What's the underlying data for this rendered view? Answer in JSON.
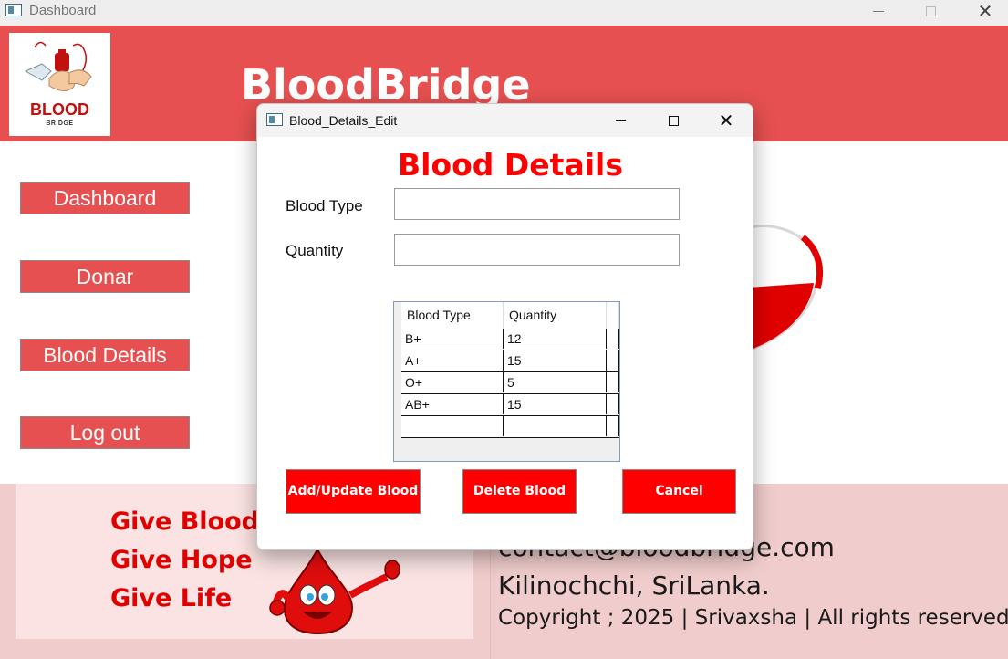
{
  "main_window": {
    "title": "Dashboard"
  },
  "header": {
    "logo_text": "BLOOD",
    "logo_subtext": "BRIDGE",
    "app_title": "BloodBridge"
  },
  "nav": {
    "dashboard": "Dashboard",
    "donar": "Donar",
    "blood_details": "Blood Details",
    "logout": "Log out"
  },
  "footer": {
    "slogan_1": "Give Blood",
    "slogan_2": "Give Hope",
    "slogan_3": "Give Life",
    "email": "contact@bloodbridge.com",
    "address": "Kilinochchi, SriLanka.",
    "copyright": "Copyright ; 2025 | Srivaxsha | All rights reserved"
  },
  "dialog": {
    "title": "Blood_Details_Edit",
    "heading": "Blood Details",
    "blood_type_label": "Blood Type",
    "quantity_label": "Quantity",
    "blood_type_value": "",
    "quantity_value": "",
    "grid": {
      "headers": [
        "Blood Type",
        "Quantity"
      ],
      "rows": [
        [
          "B+",
          "12"
        ],
        [
          "A+",
          "15"
        ],
        [
          "O+",
          "5"
        ],
        [
          "AB+",
          "15"
        ],
        [
          "",
          ""
        ]
      ]
    },
    "buttons": {
      "add_update": "Add/Update Blood",
      "delete": "Delete Blood",
      "cancel": "Cancel"
    }
  },
  "colors": {
    "header_red": "#e65050",
    "accent_red": "#ff0000",
    "footer_pink": "#f0cccc"
  }
}
